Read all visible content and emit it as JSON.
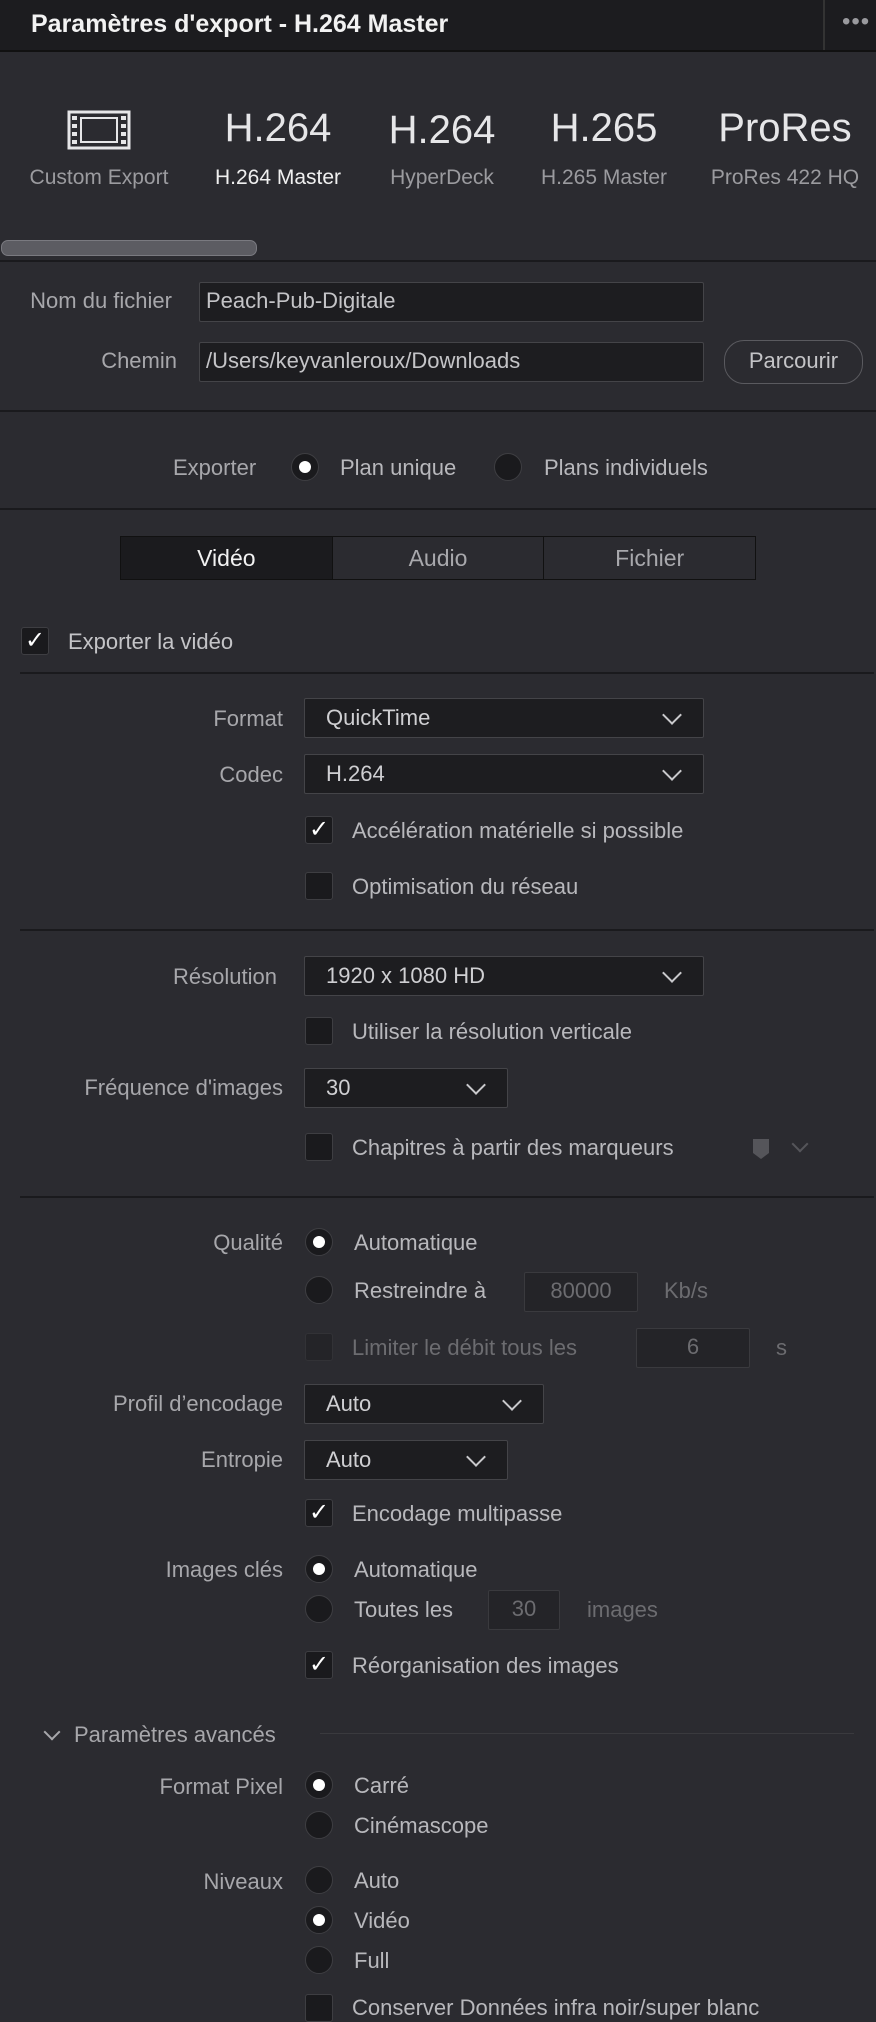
{
  "window": {
    "title": "Paramètres d'export - H.264 Master",
    "more_icon": "more-dots-icon"
  },
  "presets": [
    {
      "big": "",
      "icon": "film-strip-icon",
      "label": "Custom Export",
      "selected": false
    },
    {
      "big": "H.264",
      "label": "H.264 Master",
      "selected": true
    },
    {
      "big": "H.264",
      "label": "HyperDeck",
      "selected": false
    },
    {
      "big": "H.265",
      "label": "H.265 Master",
      "selected": false
    },
    {
      "big": "ProRes",
      "label": "ProRes 422 HQ",
      "selected": false
    }
  ],
  "file": {
    "name_label": "Nom du fichier",
    "name_value": "Peach-Pub-Digitale",
    "path_label": "Chemin",
    "path_value": "/Users/keyvanleroux/Downloads",
    "browse_label": "Parcourir"
  },
  "export_mode": {
    "label": "Exporter",
    "options": [
      {
        "label": "Plan unique",
        "selected": true
      },
      {
        "label": "Plans individuels",
        "selected": false
      }
    ]
  },
  "tabs": [
    {
      "label": "Vidéo",
      "active": true
    },
    {
      "label": "Audio",
      "active": false
    },
    {
      "label": "Fichier",
      "active": false
    }
  ],
  "video": {
    "export_video": {
      "label": "Exporter la vidéo",
      "checked": true
    },
    "format": {
      "label": "Format",
      "value": "QuickTime"
    },
    "codec": {
      "label": "Codec",
      "value": "H.264"
    },
    "hw_accel": {
      "label": "Accélération matérielle si possible",
      "checked": true
    },
    "net_opt": {
      "label": "Optimisation du réseau",
      "checked": false
    },
    "resolution": {
      "label": "Résolution",
      "value": "1920 x 1080 HD"
    },
    "vertical_res": {
      "label": "Utiliser la résolution verticale",
      "checked": false
    },
    "framerate": {
      "label": "Fréquence d'images",
      "value": "30"
    },
    "chapters": {
      "label": "Chapitres à partir des marqueurs",
      "checked": false
    },
    "quality": {
      "label": "Qualité",
      "auto_label": "Automatique",
      "auto_selected": true,
      "restrict_label": "Restreindre à",
      "restrict_value": "80000",
      "restrict_unit": "Kb/s",
      "limit_label": "Limiter le débit tous les",
      "limit_value": "6",
      "limit_unit": "s"
    },
    "encoding_profile": {
      "label": "Profil d’encodage",
      "value": "Auto"
    },
    "entropy": {
      "label": "Entropie",
      "value": "Auto"
    },
    "multipass": {
      "label": "Encodage multipasse",
      "checked": true
    },
    "keyframes": {
      "label": "Images clés",
      "auto_label": "Automatique",
      "auto_selected": true,
      "every_label": "Toutes les",
      "every_value": "30",
      "every_unit": "images"
    },
    "frame_reorder": {
      "label": "Réorganisation des images",
      "checked": true
    },
    "advanced": {
      "label": "Paramètres avancés",
      "pixel_format": {
        "label": "Format Pixel",
        "options": [
          {
            "label": "Carré",
            "selected": true
          },
          {
            "label": "Cinémascope",
            "selected": false
          }
        ]
      },
      "levels": {
        "label": "Niveaux",
        "options": [
          {
            "label": "Auto",
            "selected": false
          },
          {
            "label": "Vidéo",
            "selected": true
          },
          {
            "label": "Full",
            "selected": false
          }
        ]
      },
      "preserve_superwhite": {
        "label": "Conserver Données infra noir/super blanc",
        "checked": false
      }
    }
  }
}
